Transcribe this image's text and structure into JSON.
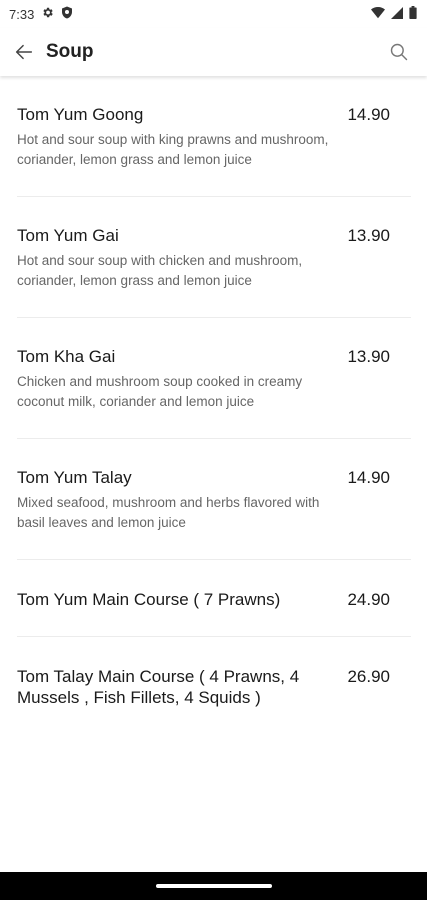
{
  "status_bar": {
    "time": "7:33"
  },
  "header": {
    "title": "Soup"
  },
  "items": [
    {
      "name": "Tom Yum Goong",
      "description": "Hot and sour soup with king prawns and mushroom, coriander, lemon grass and lemon juice",
      "price": "14.90"
    },
    {
      "name": "Tom Yum Gai",
      "description": "Hot and sour soup with chicken and mushroom, coriander, lemon grass and lemon juice",
      "price": "13.90"
    },
    {
      "name": "Tom Kha Gai",
      "description": "Chicken and mushroom soup cooked in creamy coconut milk, coriander and lemon juice",
      "price": "13.90"
    },
    {
      "name": "Tom Yum Talay",
      "description": "Mixed seafood, mushroom and herbs flavored with basil leaves and lemon juice",
      "price": "14.90"
    },
    {
      "name": "Tom Yum Main Course ( 7 Prawns)",
      "description": "",
      "price": "24.90"
    },
    {
      "name": "Tom Talay Main Course ( 4 Prawns, 4 Mussels , Fish Fillets, 4 Squids )",
      "description": "",
      "price": "26.90"
    }
  ]
}
